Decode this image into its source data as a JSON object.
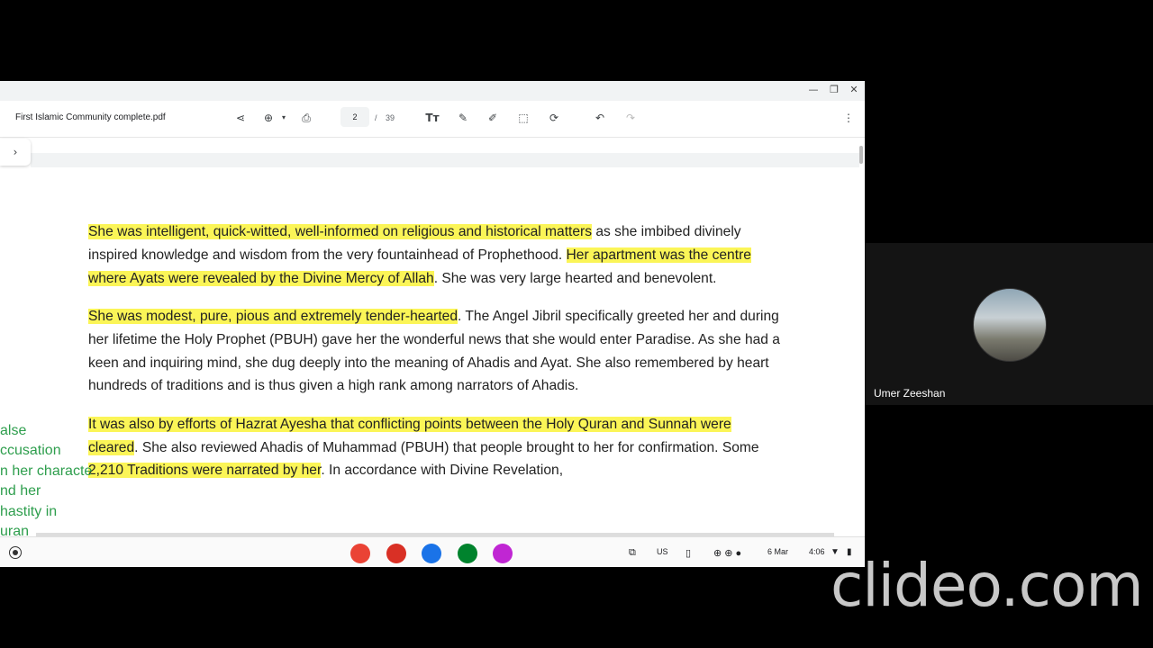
{
  "viewer": {
    "filename": "First Islamic Community complete.pdf",
    "page_current": "2",
    "page_separator": "/",
    "page_total": "39",
    "icons": {
      "share": "share-icon",
      "zoom": "zoom-in-icon",
      "print": "print-icon",
      "text": "text-icon",
      "draw": "pen-icon",
      "highlight": "highlighter-icon",
      "select": "selection-icon",
      "rotate": "rotate-icon",
      "undo": "undo-icon",
      "redo": "redo-icon",
      "menu": "more-vert-icon"
    }
  },
  "document": {
    "paragraphs": [
      [
        {
          "text": "She was intelligent, quick-witted, well-informed on religious and historical matters",
          "hl": true
        },
        {
          "text": " as she imbibed divinely inspired knowledge and wisdom from the very fountainhead of Prophethood. ",
          "hl": false
        },
        {
          "text": "Her apartment was the centre where Ayats were revealed by the Divine Mercy of Allah",
          "hl": true
        },
        {
          "text": ". She was very large hearted and benevolent.",
          "hl": false
        }
      ],
      [
        {
          "text": "She was modest, pure, pious and extremely tender-hearted",
          "hl": true
        },
        {
          "text": ". The Angel Jibril specifically greeted her and during her lifetime the Holy Prophet (PBUH) gave her the wonderful news that she would enter Paradise. As she had a keen and inquiring mind, she dug deeply into the meaning of Ahadis and Ayat. She also remembered by heart hundreds of traditions and is thus given a high rank among narrators of Ahadis.",
          "hl": false
        }
      ],
      [
        {
          "text": "It was also by efforts of Hazrat Ayesha that conflicting points between the Holy Quran and Sunnah were cleared",
          "hl": true
        },
        {
          "text": ". She also reviewed Ahadis of Muhammad (PBUH) that people brought to her for confirmation. Some ",
          "hl": false
        },
        {
          "text": "2,210 Traditions were narrated by her",
          "hl": true
        },
        {
          "text": ". In accordance with Divine Revelation,",
          "hl": false
        }
      ]
    ]
  },
  "annotation": {
    "lines": [
      "alse",
      "ccusation",
      "n her characte",
      "nd her",
      "hastity in",
      "uran"
    ],
    "color": "#2e9e4d"
  },
  "shelf": {
    "apps": [
      {
        "name": "chrome-icon",
        "color": "#ea4335"
      },
      {
        "name": "gmail-icon",
        "color": "#d93025"
      },
      {
        "name": "files-icon",
        "color": "#1a73e8"
      },
      {
        "name": "meet-icon",
        "color": "#00832d"
      },
      {
        "name": "screencast-icon",
        "color": "#c026d3"
      }
    ],
    "keyboard": "US",
    "date": "6 Mar",
    "time": "4:06"
  },
  "participant": {
    "name": "Umer Zeeshan"
  },
  "watermark": "clideo.com",
  "colors": {
    "highlight": "#fbf557"
  }
}
